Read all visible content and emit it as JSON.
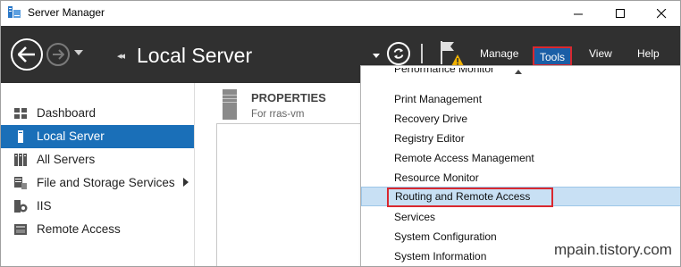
{
  "window": {
    "title": "Server Manager",
    "minimize_icon": "minimize-icon",
    "maximize_icon": "maximize-icon",
    "close_icon": "close-icon"
  },
  "header": {
    "page_title": "Local Server",
    "breadcrumb_glyph": "◂◂",
    "menus": {
      "manage": "Manage",
      "tools": "Tools",
      "view": "View",
      "help": "Help"
    },
    "colors": {
      "header_bg": "#303030",
      "tools_highlight": "#1a5ea6",
      "red_outline": "#d9282f"
    }
  },
  "sidebar": {
    "items": [
      {
        "label": "Dashboard",
        "icon": "dashboard-icon",
        "active": false
      },
      {
        "label": "Local Server",
        "icon": "local-server-icon",
        "active": true
      },
      {
        "label": "All Servers",
        "icon": "all-servers-icon",
        "active": false
      },
      {
        "label": "File and Storage Services",
        "icon": "file-storage-icon",
        "active": false,
        "has_submenu": true
      },
      {
        "label": "IIS",
        "icon": "iis-icon",
        "active": false
      },
      {
        "label": "Remote Access",
        "icon": "remote-access-icon",
        "active": false
      }
    ],
    "active_color": "#1a6fb8"
  },
  "properties": {
    "title": "PROPERTIES",
    "subtitle": "For rras-vm"
  },
  "tools_menu": {
    "items": [
      "Performance Monitor",
      "Print Management",
      "Recovery Drive",
      "Registry Editor",
      "Remote Access Management",
      "Resource Monitor",
      "Routing and Remote Access",
      "Services",
      "System Configuration",
      "System Information"
    ],
    "highlighted": "Routing and Remote Access",
    "highlight_color": "#c8e0f4"
  },
  "watermark": "mpain.tistory.com"
}
